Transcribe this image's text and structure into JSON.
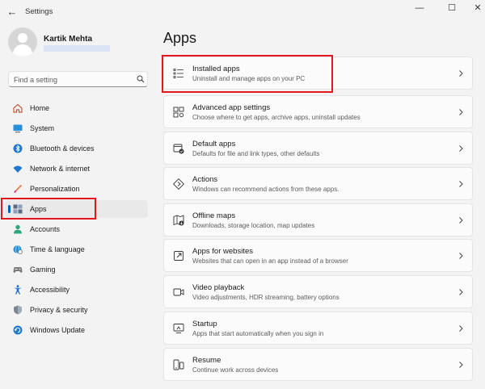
{
  "window": {
    "title": "Settings",
    "back_glyph": "←",
    "min_glyph": "—",
    "max_glyph": "☐",
    "close_glyph": "✕"
  },
  "profile": {
    "name": "Kartik Mehta"
  },
  "search": {
    "placeholder": "Find a setting"
  },
  "nav": {
    "items": [
      {
        "label": "Home",
        "icon": "home-icon"
      },
      {
        "label": "System",
        "icon": "system-icon"
      },
      {
        "label": "Bluetooth & devices",
        "icon": "bluetooth-icon"
      },
      {
        "label": "Network & internet",
        "icon": "wifi-icon"
      },
      {
        "label": "Personalization",
        "icon": "brush-icon"
      },
      {
        "label": "Apps",
        "icon": "apps-icon",
        "selected": true
      },
      {
        "label": "Accounts",
        "icon": "accounts-icon"
      },
      {
        "label": "Time & language",
        "icon": "globe-clock-icon"
      },
      {
        "label": "Gaming",
        "icon": "gamepad-icon"
      },
      {
        "label": "Accessibility",
        "icon": "accessibility-icon"
      },
      {
        "label": "Privacy & security",
        "icon": "shield-icon"
      },
      {
        "label": "Windows Update",
        "icon": "update-icon"
      }
    ]
  },
  "main": {
    "title": "Apps",
    "cards": [
      {
        "title": "Installed apps",
        "desc": "Uninstall and manage apps on your PC",
        "icon": "installed-apps-icon"
      },
      {
        "title": "Advanced app settings",
        "desc": "Choose where to get apps, archive apps, uninstall updates",
        "icon": "advanced-apps-icon"
      },
      {
        "title": "Default apps",
        "desc": "Defaults for file and link types, other defaults",
        "icon": "default-apps-icon"
      },
      {
        "title": "Actions",
        "desc": "Windows can recommend actions from these apps.",
        "icon": "actions-icon"
      },
      {
        "title": "Offline maps",
        "desc": "Downloads, storage location, map updates",
        "icon": "map-icon"
      },
      {
        "title": "Apps for websites",
        "desc": "Websites that can open in an app instead of a browser",
        "icon": "open-external-icon"
      },
      {
        "title": "Video playback",
        "desc": "Video adjustments, HDR streaming, battery options",
        "icon": "video-icon"
      },
      {
        "title": "Startup",
        "desc": "Apps that start automatically when you sign in",
        "icon": "startup-icon"
      },
      {
        "title": "Resume",
        "desc": "Continue work across devices",
        "icon": "resume-icon"
      }
    ]
  },
  "colors": {
    "accent": "#005fb8",
    "highlight": "#e3161b",
    "background": "#f3f3f3",
    "card": "#fbfbfb"
  }
}
